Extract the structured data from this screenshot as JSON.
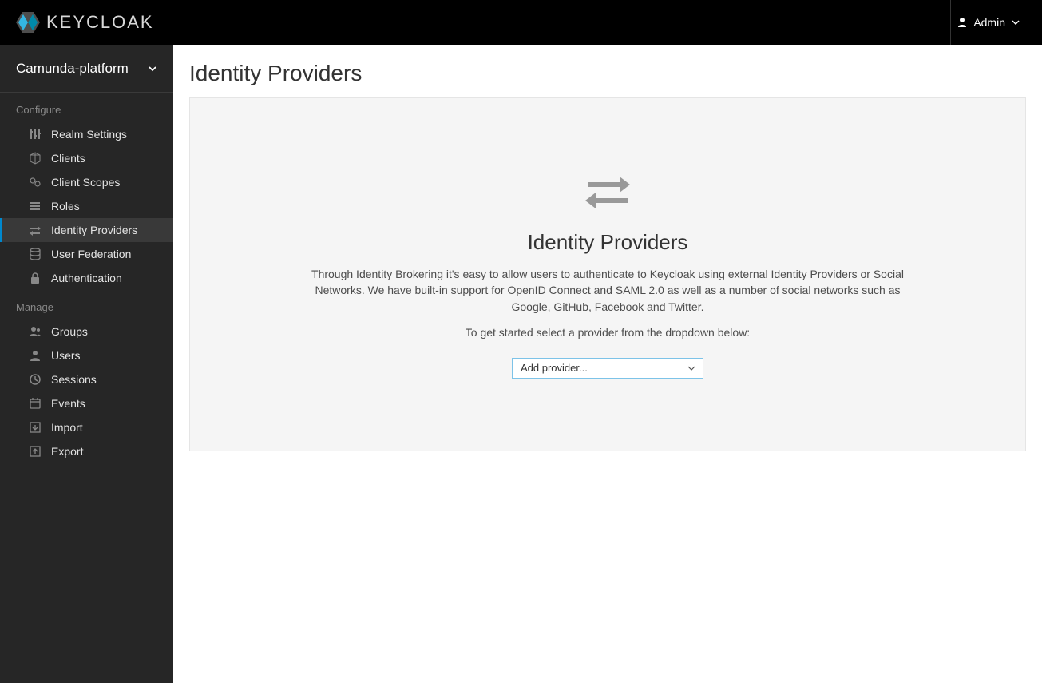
{
  "header": {
    "brand": "KEYCLOAK",
    "user_label": "Admin"
  },
  "sidebar": {
    "realm": "Camunda-platform",
    "sections": [
      {
        "title": "Configure",
        "items": [
          {
            "label": "Realm Settings",
            "icon": "sliders",
            "active": false
          },
          {
            "label": "Clients",
            "icon": "cube",
            "active": false
          },
          {
            "label": "Client Scopes",
            "icon": "scopes",
            "active": false
          },
          {
            "label": "Roles",
            "icon": "list",
            "active": false
          },
          {
            "label": "Identity Providers",
            "icon": "exchange",
            "active": true
          },
          {
            "label": "User Federation",
            "icon": "database",
            "active": false
          },
          {
            "label": "Authentication",
            "icon": "lock",
            "active": false
          }
        ]
      },
      {
        "title": "Manage",
        "items": [
          {
            "label": "Groups",
            "icon": "users",
            "active": false
          },
          {
            "label": "Users",
            "icon": "user",
            "active": false
          },
          {
            "label": "Sessions",
            "icon": "clock",
            "active": false
          },
          {
            "label": "Events",
            "icon": "calendar",
            "active": false
          },
          {
            "label": "Import",
            "icon": "import",
            "active": false
          },
          {
            "label": "Export",
            "icon": "export",
            "active": false
          }
        ]
      }
    ]
  },
  "main": {
    "title": "Identity Providers",
    "panel": {
      "heading": "Identity Providers",
      "description": "Through Identity Brokering it's easy to allow users to authenticate to Keycloak using external Identity Providers or Social Networks.\nWe have built-in support for OpenID Connect and SAML 2.0 as well as a number of social networks such as Google, GitHub, Facebook and Twitter.",
      "cta": "To get started select a provider from the dropdown below:",
      "select_placeholder": "Add provider..."
    }
  }
}
